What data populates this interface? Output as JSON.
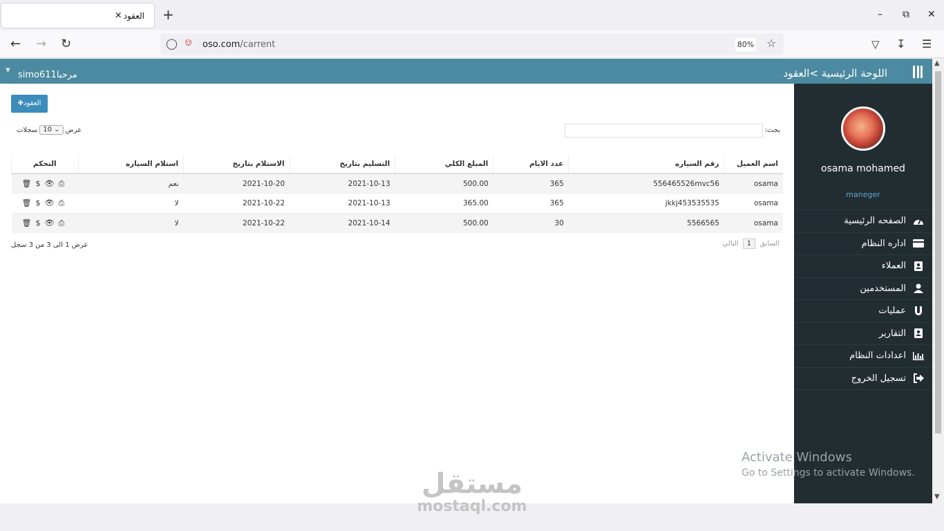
{
  "browser": {
    "tab_title": "العقود",
    "tab_close": "×",
    "new_tab": "+",
    "url_domain": "oso.com",
    "url_path": "/carrent",
    "zoom": "80%"
  },
  "topbar": {
    "welcome": "مرحبا",
    "username": "simo611",
    "breadcrumb": "اللوحة الرئيسية >العقود"
  },
  "sidebar": {
    "user_name": "osama mohamed",
    "user_role": "maneger",
    "items": [
      {
        "label": "الصفحه الرئيسية",
        "icon": "dashboard-icon"
      },
      {
        "label": "اداره النظام",
        "icon": "credit-card-icon"
      },
      {
        "label": "العملاء",
        "icon": "contact-card-icon"
      },
      {
        "label": "المستخدمين",
        "icon": "user-icon"
      },
      {
        "label": "عمليات",
        "icon": "magnet-icon"
      },
      {
        "label": "التقارير",
        "icon": "report-card-icon"
      },
      {
        "label": "اعدادات النظام",
        "icon": "bar-chart-icon"
      },
      {
        "label": "تسجيل الخروج",
        "icon": "sign-out-icon"
      }
    ]
  },
  "content": {
    "add_button": "العقود",
    "length_show": "عرض",
    "length_value": "10",
    "length_records": "سجلات",
    "search_label": "بحث:",
    "columns": [
      "اسم العميل",
      "رقم السياره",
      "عدد الايام",
      "المبلغ الكلي",
      "التسليم بتاريخ",
      "الاستلام بتاريخ",
      "استلام السياره",
      "التحكم"
    ],
    "rows": [
      [
        "osama",
        "556465526mvc56",
        "365",
        "500.00",
        "2021-10-13",
        "2021-10-20",
        "نعم"
      ],
      [
        "osama",
        "jkkj453535535",
        "365",
        "365.00",
        "2021-10-13",
        "2021-10-22",
        "لا"
      ],
      [
        "osama",
        "5566565",
        "30",
        "500.00",
        "2021-10-14",
        "2021-10-22",
        "لا"
      ]
    ],
    "info": "عرض 1 الى 3 من 3 سجل",
    "pager_prev": "السابق",
    "pager_current": "1",
    "pager_next": "التالي"
  },
  "overlay": {
    "activate_title": "Activate Windows",
    "activate_sub": "Go to Settings to activate Windows.",
    "brand_ar": "مستقل",
    "brand_en": "mostaql.com"
  },
  "colors": {
    "topbar": "#4b8aa0",
    "sidebar": "#222d32",
    "button": "#3c8dbc"
  }
}
